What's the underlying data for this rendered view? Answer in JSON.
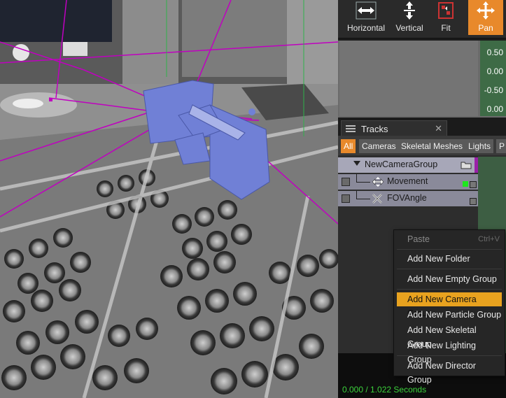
{
  "toolbar": {
    "buttons": [
      {
        "label": "Horizontal",
        "icon": "horizontal-arrows-icon",
        "active": false
      },
      {
        "label": "Vertical",
        "icon": "vertical-arrows-icon",
        "active": false
      },
      {
        "label": "Fit",
        "icon": "fit-icon",
        "active": false
      },
      {
        "label": "Pan",
        "icon": "pan-icon",
        "active": true
      }
    ]
  },
  "curve_editor": {
    "axis_labels": [
      "0.50",
      "0.00",
      "-0.50",
      "0.00"
    ]
  },
  "tracks": {
    "tab_title": "Tracks",
    "filters": [
      "All",
      "Cameras",
      "Skeletal Meshes",
      "Lights",
      "P"
    ],
    "group_name": "NewCameraGroup",
    "tracks": [
      "Movement",
      "FOVAngle"
    ]
  },
  "time_readout": "0.000 / 1.022 Seconds",
  "context_menu": {
    "items": [
      {
        "label": "Paste",
        "shortcut": "Ctrl+V",
        "disabled": true
      },
      {
        "label": "Add New Folder"
      },
      {
        "label": "Add New Empty Group"
      },
      {
        "label": "Add New Camera Group",
        "highlighted": true
      },
      {
        "label": "Add New Particle Group"
      },
      {
        "label": "Add New Skeletal Group"
      },
      {
        "label": "Add New Lighting Group"
      },
      {
        "label": "Add New Director Group"
      }
    ]
  },
  "colors": {
    "accent": "#e8892b",
    "menu_highlight": "#e8a21f",
    "time_text": "#3bd23b",
    "camera_mesh": "#6f7fd6"
  }
}
